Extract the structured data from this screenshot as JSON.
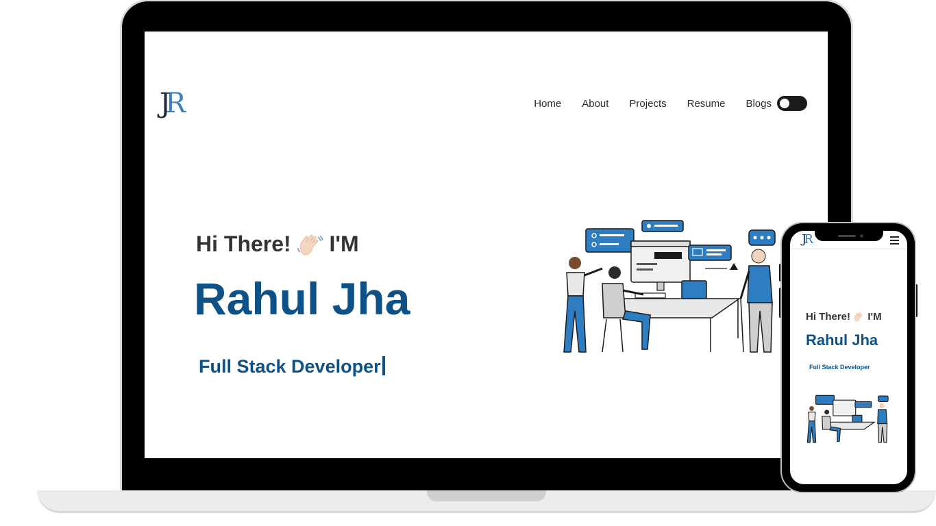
{
  "site": {
    "logo": {
      "j": "J",
      "r": "R"
    },
    "nav": [
      "Home",
      "About",
      "Projects",
      "Resume",
      "Blogs"
    ],
    "theme_toggle": "dark-mode-toggle",
    "hero": {
      "greeting_pre": "Hi There!",
      "greeting_post": "I'M",
      "name": "Rahul Jha",
      "role": "Full Stack Developer"
    }
  },
  "colors": {
    "accent": "#0d5187",
    "illustration_blue": "#2f7dc1",
    "text_dark": "#333333"
  },
  "icons": [
    "wave-icon",
    "hamburger-icon",
    "developer-illustration"
  ]
}
